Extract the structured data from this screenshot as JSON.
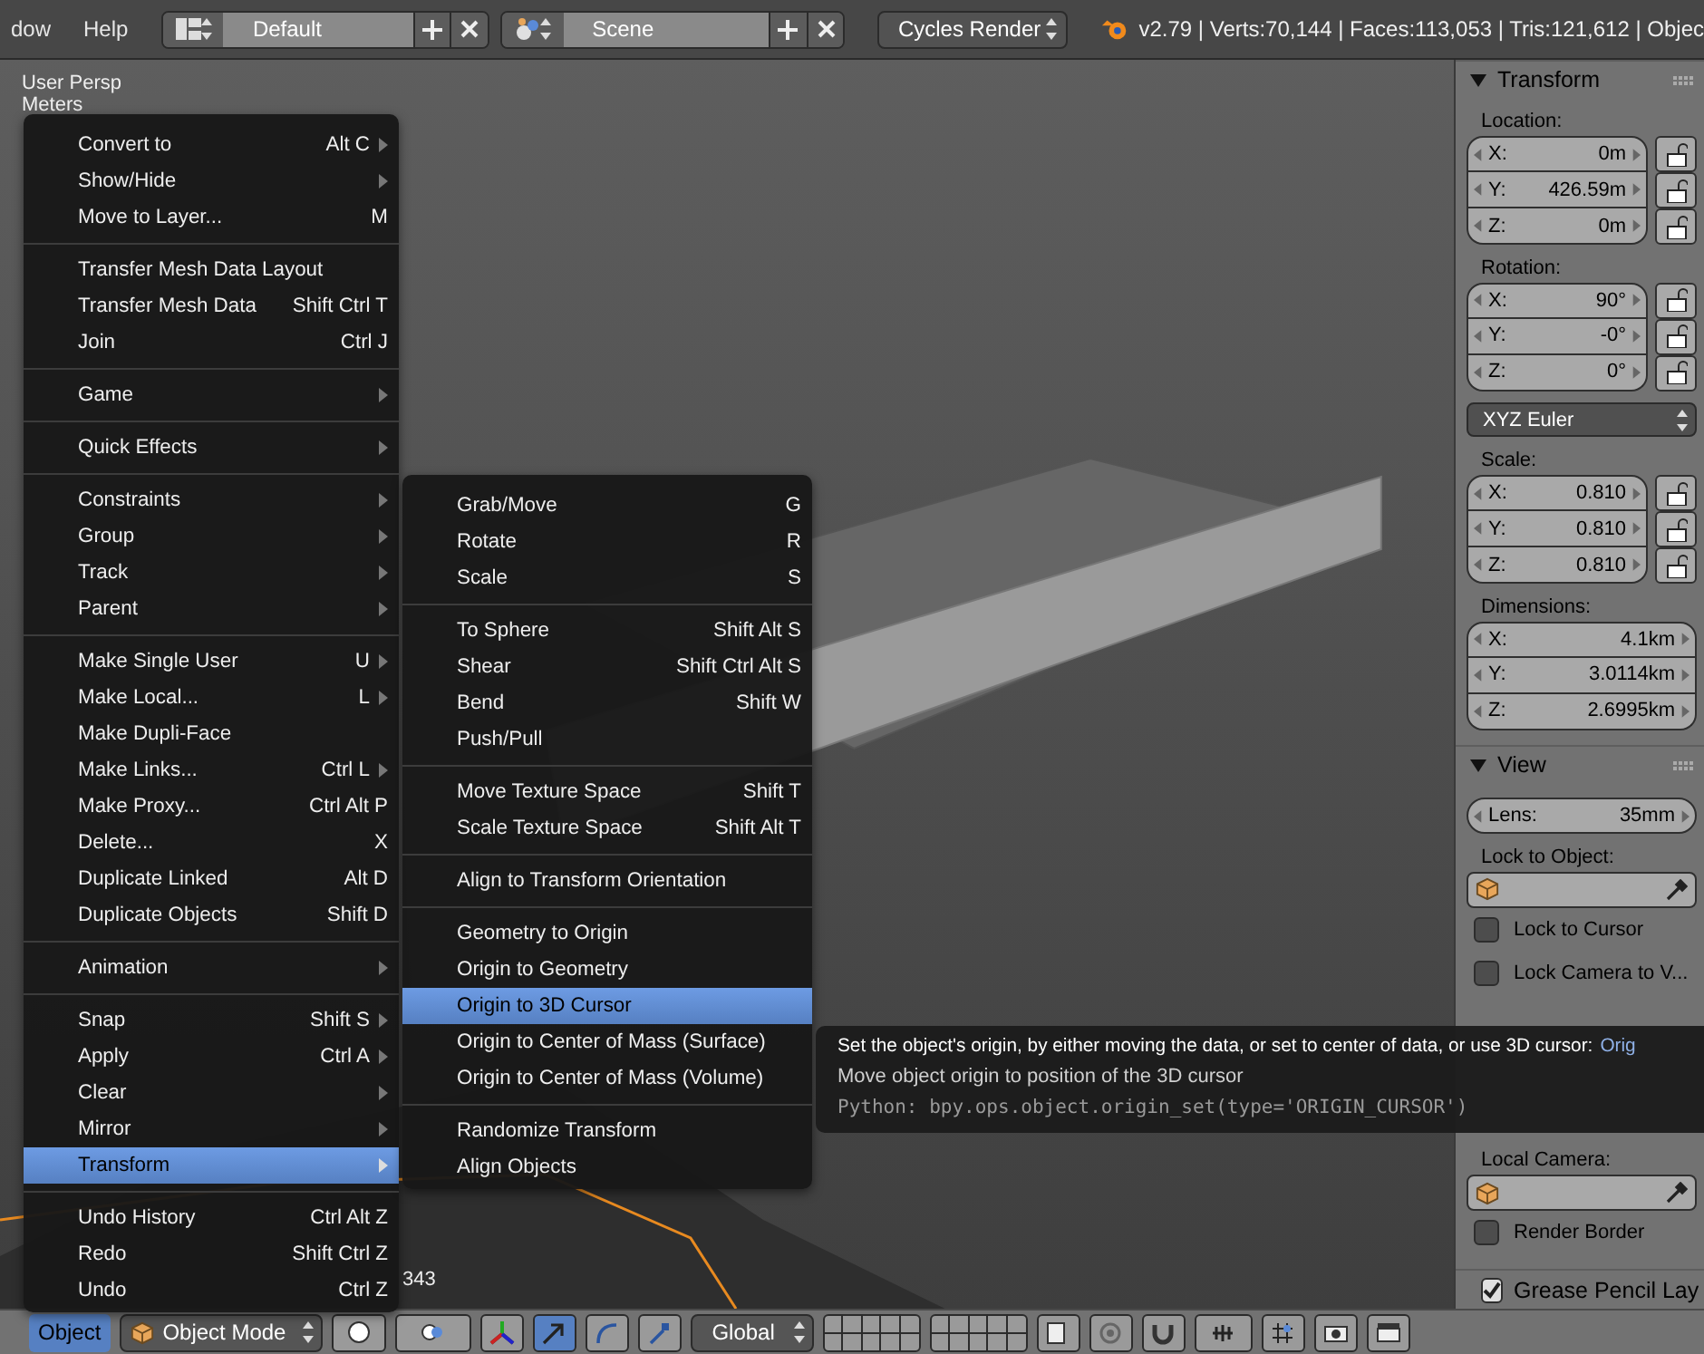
{
  "header": {
    "menus": [
      "dow",
      "Help"
    ],
    "layout": "Default",
    "scene": "Scene",
    "render_engine": "Cycles Render",
    "stats": "v2.79 | Verts:70,144 | Faces:113,053 | Tris:121,612 | Objec"
  },
  "viewport": {
    "view_name": "User Persp",
    "units": "Meters",
    "object_info": "343"
  },
  "object_menu": {
    "sections": [
      {
        "items": [
          {
            "label": "Convert to",
            "shortcut": "Alt C",
            "submenu": true,
            "selected": false
          },
          {
            "label": "Show/Hide",
            "submenu": true,
            "selected": false
          },
          {
            "label": "Move to Layer...",
            "shortcut": "M",
            "submenu": false,
            "selected": false
          }
        ]
      },
      {
        "items": [
          {
            "label": "Transfer Mesh Data Layout",
            "submenu": false,
            "selected": false
          },
          {
            "label": "Transfer Mesh Data",
            "shortcut": "Shift Ctrl T",
            "submenu": false,
            "selected": false
          },
          {
            "label": "Join",
            "shortcut": "Ctrl J",
            "submenu": false,
            "selected": false
          }
        ]
      },
      {
        "items": [
          {
            "label": "Game",
            "submenu": true,
            "selected": false
          }
        ]
      },
      {
        "items": [
          {
            "label": "Quick Effects",
            "submenu": true,
            "selected": false
          }
        ]
      },
      {
        "items": [
          {
            "label": "Constraints",
            "submenu": true,
            "selected": false
          },
          {
            "label": "Group",
            "submenu": true,
            "selected": false
          },
          {
            "label": "Track",
            "submenu": true,
            "selected": false
          },
          {
            "label": "Parent",
            "submenu": true,
            "selected": false
          }
        ]
      },
      {
        "items": [
          {
            "label": "Make Single User",
            "shortcut": "U",
            "submenu": true,
            "selected": false
          },
          {
            "label": "Make Local...",
            "shortcut": "L",
            "submenu": true,
            "selected": false
          },
          {
            "label": "Make Dupli-Face",
            "submenu": false,
            "selected": false
          },
          {
            "label": "Make Links...",
            "shortcut": "Ctrl L",
            "submenu": true,
            "selected": false
          },
          {
            "label": "Make Proxy...",
            "shortcut": "Ctrl Alt P",
            "submenu": false,
            "selected": false
          },
          {
            "label": "Delete...",
            "shortcut": "X",
            "submenu": false,
            "selected": false
          },
          {
            "label": "Duplicate Linked",
            "shortcut": "Alt D",
            "submenu": false,
            "selected": false
          },
          {
            "label": "Duplicate Objects",
            "shortcut": "Shift D",
            "submenu": false,
            "selected": false
          }
        ]
      },
      {
        "items": [
          {
            "label": "Animation",
            "submenu": true,
            "selected": false
          }
        ]
      },
      {
        "items": [
          {
            "label": "Snap",
            "shortcut": "Shift S",
            "submenu": true,
            "selected": false
          },
          {
            "label": "Apply",
            "shortcut": "Ctrl A",
            "submenu": true,
            "selected": false
          },
          {
            "label": "Clear",
            "submenu": true,
            "selected": false
          },
          {
            "label": "Mirror",
            "submenu": true,
            "selected": false
          },
          {
            "label": "Transform",
            "submenu": true,
            "selected": true
          }
        ]
      },
      {
        "items": [
          {
            "label": "Undo History",
            "shortcut": "Ctrl Alt Z",
            "submenu": false,
            "selected": false
          },
          {
            "label": "Redo",
            "shortcut": "Shift Ctrl Z",
            "submenu": false,
            "selected": false
          },
          {
            "label": "Undo",
            "shortcut": "Ctrl Z",
            "submenu": false,
            "selected": false
          }
        ]
      }
    ]
  },
  "transform_menu": {
    "sections": [
      {
        "items": [
          {
            "label": "Grab/Move",
            "shortcut": "G",
            "submenu": false,
            "selected": false
          },
          {
            "label": "Rotate",
            "shortcut": "R",
            "submenu": false,
            "selected": false
          },
          {
            "label": "Scale",
            "shortcut": "S",
            "submenu": false,
            "selected": false
          }
        ]
      },
      {
        "items": [
          {
            "label": "To Sphere",
            "shortcut": "Shift Alt S",
            "submenu": false,
            "selected": false
          },
          {
            "label": "Shear",
            "shortcut": "Shift Ctrl Alt S",
            "submenu": false,
            "selected": false
          },
          {
            "label": "Bend",
            "shortcut": "Shift W",
            "submenu": false,
            "selected": false
          },
          {
            "label": "Push/Pull",
            "submenu": false,
            "selected": false
          }
        ]
      },
      {
        "items": [
          {
            "label": "Move Texture Space",
            "shortcut": "Shift T",
            "submenu": false,
            "selected": false
          },
          {
            "label": "Scale Texture Space",
            "shortcut": "Shift Alt T",
            "submenu": false,
            "selected": false
          }
        ]
      },
      {
        "items": [
          {
            "label": "Align to Transform Orientation",
            "submenu": false,
            "selected": false
          }
        ]
      },
      {
        "items": [
          {
            "label": "Geometry to Origin",
            "submenu": false,
            "selected": false
          },
          {
            "label": "Origin to Geometry",
            "submenu": false,
            "selected": false
          },
          {
            "label": "Origin to 3D Cursor",
            "submenu": false,
            "selected": true
          },
          {
            "label": "Origin to Center of Mass (Surface)",
            "submenu": false,
            "selected": false
          },
          {
            "label": "Origin to Center of Mass (Volume)",
            "submenu": false,
            "selected": false
          }
        ]
      },
      {
        "items": [
          {
            "label": "Randomize Transform",
            "submenu": false,
            "selected": false
          },
          {
            "label": "Align Objects",
            "submenu": false,
            "selected": false
          }
        ]
      }
    ]
  },
  "tooltip": {
    "description": "Set the object's origin, by either moving the data, or set to center of data, or use 3D cursor:",
    "operator": "Orig",
    "detail": "Move object origin to position of the 3D cursor",
    "python": "Python: bpy.ops.object.origin_set(type='ORIGIN_CURSOR')"
  },
  "properties": {
    "panels": [
      {
        "title": "Transform",
        "expanded": true,
        "rows": [
          {
            "kind": "label",
            "text": "Location:"
          },
          {
            "kind": "vector",
            "locks": true,
            "fields": [
              {
                "axis": "X:",
                "value": "0m"
              },
              {
                "axis": "Y:",
                "value": "426.59m"
              },
              {
                "axis": "Z:",
                "value": "0m"
              }
            ]
          },
          {
            "kind": "label",
            "text": "Rotation:"
          },
          {
            "kind": "vector",
            "locks": true,
            "fields": [
              {
                "axis": "X:",
                "value": "90°"
              },
              {
                "axis": "Y:",
                "value": "-0°"
              },
              {
                "axis": "Z:",
                "value": "0°"
              }
            ]
          },
          {
            "kind": "dropdown",
            "text": "XYZ Euler"
          },
          {
            "kind": "label",
            "text": "Scale:"
          },
          {
            "kind": "vector",
            "locks": true,
            "fields": [
              {
                "axis": "X:",
                "value": "0.810"
              },
              {
                "axis": "Y:",
                "value": "0.810"
              },
              {
                "axis": "Z:",
                "value": "0.810"
              }
            ]
          },
          {
            "kind": "label",
            "text": "Dimensions:"
          },
          {
            "kind": "vector",
            "locks": false,
            "fields": [
              {
                "axis": "X:",
                "value": "4.1km"
              },
              {
                "axis": "Y:",
                "value": "3.0114km"
              },
              {
                "axis": "Z:",
                "value": "2.6995km"
              }
            ]
          }
        ]
      },
      {
        "title": "View",
        "expanded": true,
        "rows": [
          {
            "kind": "number",
            "label": "Lens:",
            "value": "35mm"
          },
          {
            "kind": "label",
            "text": "Lock to Object:"
          },
          {
            "kind": "object"
          },
          {
            "kind": "checkbox",
            "text": "Lock to Cursor",
            "checked": false
          },
          {
            "kind": "checkbox",
            "text": "Lock Camera to V...",
            "checked": false
          },
          {
            "kind": "covered",
            "text": "Local Camera:"
          },
          {
            "kind": "object"
          },
          {
            "kind": "checkbox",
            "text": "Render Border",
            "checked": false
          }
        ]
      },
      {
        "title": "Grease Pencil Lay",
        "expanded": true,
        "checkbox": true
      }
    ]
  },
  "bottom_bar": {
    "menu": {
      "label": "Object",
      "selected": true
    },
    "mode": "Object Mode",
    "manipulators": [
      {
        "selected": true
      },
      {
        "selected": false
      },
      {
        "selected": false
      }
    ],
    "orientation": "Global"
  }
}
